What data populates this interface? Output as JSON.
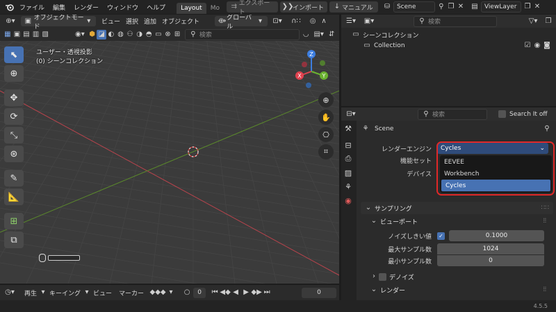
{
  "topbar": {
    "menus": [
      "ファイル",
      "編集",
      "レンダー",
      "ウィンドウ",
      "ヘルプ"
    ],
    "workspace_tabs": [
      "Layout",
      "Mo"
    ],
    "export_label": "エクスポート",
    "import_label": "インポート",
    "manual_label": "マニュアル",
    "scene_name": "Scene",
    "viewlayer_name": "ViewLayer"
  },
  "viewport": {
    "mode_label": "オブジェクトモード",
    "menus": [
      "ビュー",
      "選択",
      "追加",
      "オブジェクト"
    ],
    "orientation_label": "グローバル",
    "search_placeholder": "検索",
    "view_name": "ユーザー・透視投影",
    "collection_name": "(0) シーンコレクション",
    "axis_x": "X",
    "axis_y": "Y",
    "axis_z": "Z"
  },
  "timeline": {
    "playback_label": "再生",
    "keying_label": "キーイング",
    "view_label": "ビュー",
    "marker_label": "マーカー",
    "current_frame": "0",
    "end_frame": "0"
  },
  "outliner": {
    "search_placeholder": "検索",
    "scene_collection": "シーンコレクション",
    "collection": "Collection"
  },
  "properties": {
    "search_placeholder": "検索",
    "search_toggle_label": "Search It off",
    "context_name": "Scene",
    "render_engine_label": "レンダーエンジン",
    "render_engine_value": "Cycles",
    "feature_set_label": "機能セット",
    "device_label": "デバイス",
    "engine_options": [
      "EEVEE",
      "Workbench",
      "Cycles"
    ],
    "sampling_label": "サンプリング",
    "viewport_label": "ビューポート",
    "noise_threshold_label": "ノイズしきい値",
    "noise_threshold_value": "0.1000",
    "max_samples_label": "最大サンプル数",
    "max_samples_value": "1024",
    "min_samples_label": "最小サンプル数",
    "min_samples_value": "0",
    "denoise_label": "デノイズ",
    "render_label": "レンダー"
  },
  "statusbar": {
    "version": "4.5.5"
  },
  "colors": {
    "accent": "#4772b3",
    "highlight_border": "#e02828",
    "axis_x": "#e0424f",
    "axis_y": "#6ab230",
    "axis_z": "#3d7ee0"
  }
}
